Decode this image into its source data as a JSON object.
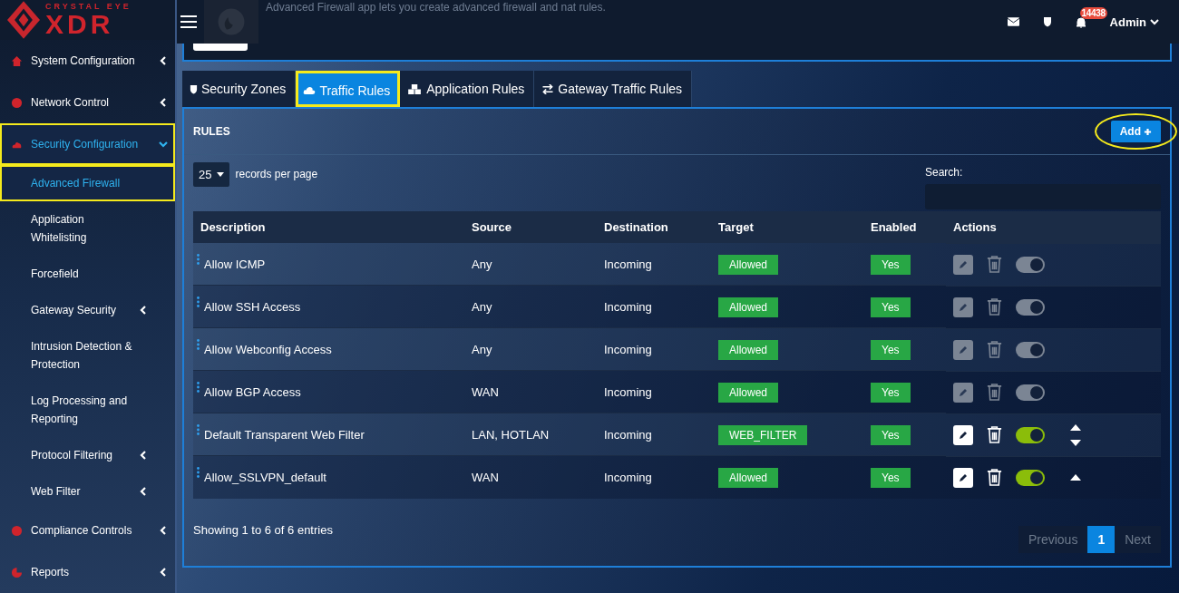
{
  "brand": {
    "tagline": "CRYSTAL EYE",
    "name": "XDR"
  },
  "header": {
    "app_description": "Advanced Firewall app lets you create advanced firewall and nat rules.",
    "notification_count": "14438",
    "user": "Admin"
  },
  "sidebar": {
    "items": [
      {
        "label": "System Configuration",
        "selected": false,
        "highlighted": false,
        "expandable": true,
        "expanded": false
      },
      {
        "label": "Network Control",
        "selected": false,
        "highlighted": false,
        "expandable": true,
        "expanded": false
      },
      {
        "label": "Security Configuration",
        "selected": true,
        "highlighted": true,
        "expandable": true,
        "expanded": true,
        "children": [
          {
            "label": "Advanced Firewall",
            "selected": true,
            "highlighted": true,
            "expandable": false
          },
          {
            "label": "Application Whitelisting",
            "selected": false,
            "highlighted": false,
            "expandable": false
          },
          {
            "label": "Forcefield",
            "selected": false,
            "highlighted": false,
            "expandable": false
          },
          {
            "label": "Gateway Security",
            "selected": false,
            "highlighted": false,
            "expandable": true
          },
          {
            "label": "Intrusion Detection & Protection",
            "selected": false,
            "highlighted": false,
            "expandable": false
          },
          {
            "label": "Log Processing and Reporting",
            "selected": false,
            "highlighted": false,
            "expandable": false
          },
          {
            "label": "Protocol Filtering",
            "selected": false,
            "highlighted": false,
            "expandable": true
          },
          {
            "label": "Web Filter",
            "selected": false,
            "highlighted": false,
            "expandable": true
          }
        ]
      },
      {
        "label": "Compliance Controls",
        "selected": false,
        "highlighted": false,
        "expandable": true,
        "expanded": false
      },
      {
        "label": "Reports",
        "selected": false,
        "highlighted": false,
        "expandable": true,
        "expanded": false
      }
    ]
  },
  "tabs": [
    {
      "label": "Security Zones",
      "selected": false,
      "highlighted": false
    },
    {
      "label": "Traffic Rules",
      "selected": true,
      "highlighted": true
    },
    {
      "label": "Application Rules",
      "selected": false,
      "highlighted": false
    },
    {
      "label": "Gateway Traffic Rules",
      "selected": false,
      "highlighted": false
    }
  ],
  "panel": {
    "title": "RULES",
    "add_button": {
      "label": "Add",
      "highlighted": true
    },
    "page_size": "25",
    "page_size_label": "records per page",
    "search_label": "Search:",
    "table": {
      "columns": [
        "Description",
        "Source",
        "Destination",
        "Target",
        "Enabled",
        "Actions"
      ],
      "rows": [
        {
          "description": "Allow ICMP",
          "source": "Any",
          "destination": "Incoming",
          "target": "Allowed",
          "enabled": "Yes",
          "disabled": true,
          "move_up": false,
          "move_down": false
        },
        {
          "description": "Allow SSH Access",
          "source": "Any",
          "destination": "Incoming",
          "target": "Allowed",
          "enabled": "Yes",
          "disabled": true,
          "move_up": false,
          "move_down": false
        },
        {
          "description": "Allow Webconfig Access",
          "source": "Any",
          "destination": "Incoming",
          "target": "Allowed",
          "enabled": "Yes",
          "disabled": true,
          "move_up": false,
          "move_down": false
        },
        {
          "description": "Allow BGP Access",
          "source": "WAN",
          "destination": "Incoming",
          "target": "Allowed",
          "enabled": "Yes",
          "disabled": true,
          "move_up": false,
          "move_down": false
        },
        {
          "description": "Default Transparent Web Filter",
          "source": "LAN, HOTLAN",
          "destination": "Incoming",
          "target": "WEB_FILTER",
          "enabled": "Yes",
          "disabled": false,
          "move_up": true,
          "move_down": true
        },
        {
          "description": "Allow_SSLVPN_default",
          "source": "WAN",
          "destination": "Incoming",
          "target": "Allowed",
          "enabled": "Yes",
          "disabled": false,
          "move_up": true,
          "move_down": false
        }
      ]
    },
    "info": "Showing 1 to 6 of 6 entries",
    "pagination": [
      {
        "label": "Previous",
        "kind": "nav",
        "selected": false
      },
      {
        "label": "1",
        "kind": "page",
        "selected": true
      },
      {
        "label": "Next",
        "kind": "nav",
        "selected": false
      }
    ]
  }
}
